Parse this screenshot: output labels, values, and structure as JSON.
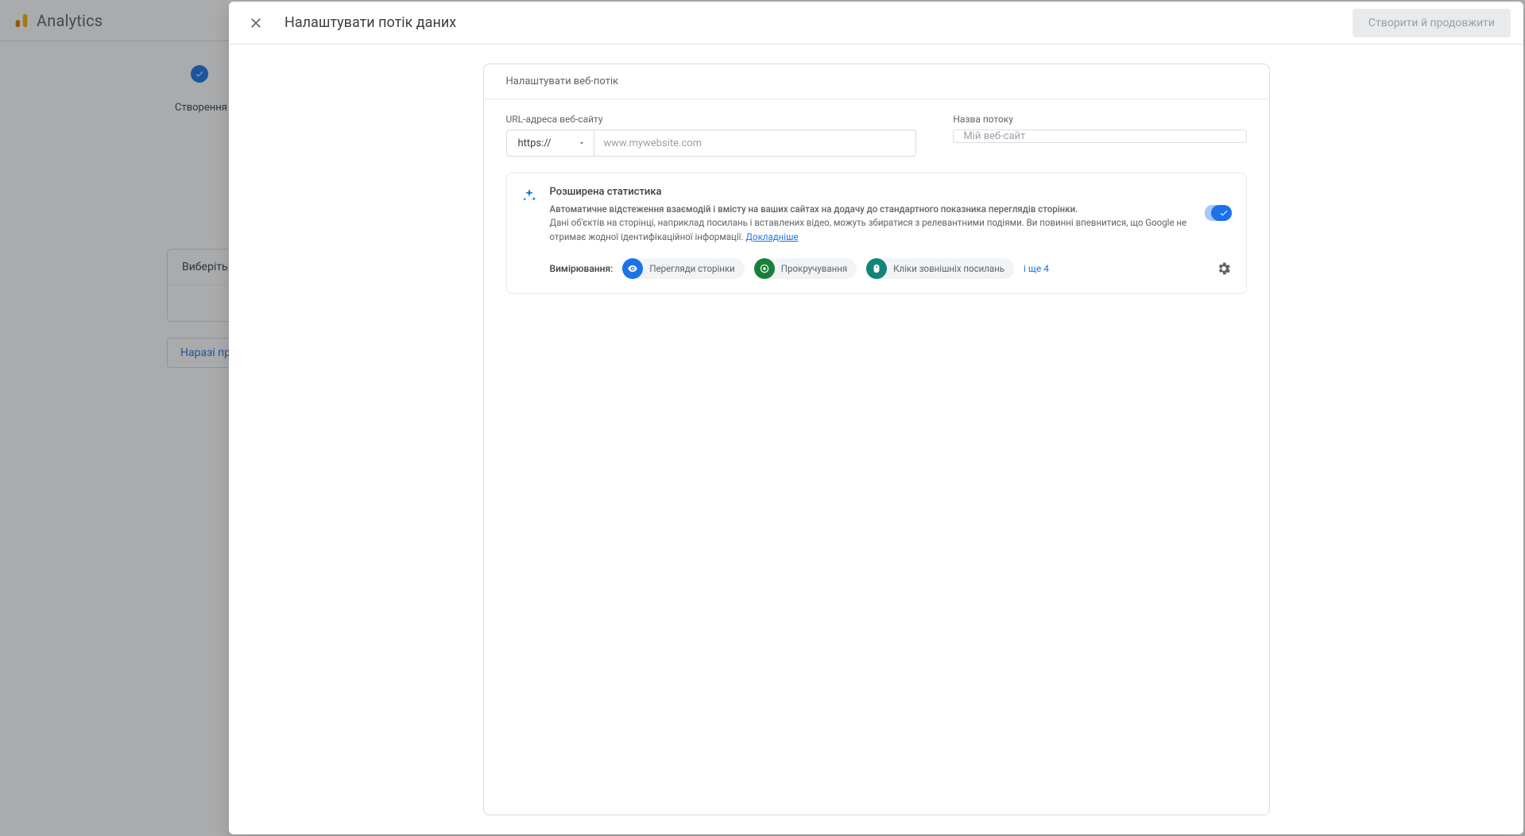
{
  "app": {
    "name": "Analytics"
  },
  "bg": {
    "step1_label": "Створення облікового",
    "platform_label": "Виберіть платфор",
    "skip_label": "Наразі пропустити"
  },
  "panel": {
    "title": "Налаштувати потік даних",
    "create_button": "Створити й продовжити"
  },
  "card": {
    "header": "Налаштувати веб-потік",
    "url_label": "URL-адреса веб-сайту",
    "protocol_value": "https://",
    "url_placeholder": "www.mywebsite.com",
    "name_label": "Назва потоку",
    "name_placeholder": "Мій веб-сайт"
  },
  "enhanced": {
    "title": "Розширена статистика",
    "desc_bold": "Автоматичне відстеження взаємодій і вмісту на ваших сайтах на додачу до стандартного показника переглядів сторінки.",
    "desc_rest": "Дані об'єктів на сторінці, наприклад посилань і вставлених відео, можуть збиратися з релевантними подіями. Ви повинні впевнитися, що Google не отримає жодної ідентифікаційної інформації. ",
    "learn_more": "Докладніше"
  },
  "measure": {
    "label": "Вимірювання:",
    "chips": [
      {
        "label": "Перегляди сторінки",
        "color": "blue",
        "icon": "eye"
      },
      {
        "label": "Прокручування",
        "color": "green",
        "icon": "target"
      },
      {
        "label": "Кліки зовнішніх посилань",
        "color": "teal",
        "icon": "mouse"
      }
    ],
    "more": "і ще 4"
  }
}
